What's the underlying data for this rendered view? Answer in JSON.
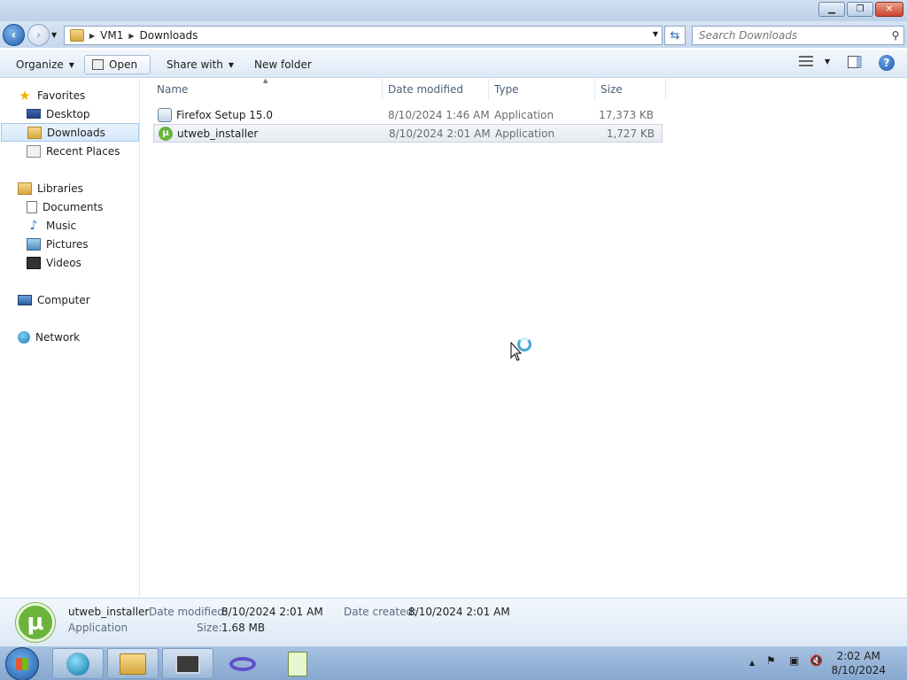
{
  "window": {
    "minimize_glyph": "▁",
    "maximize_glyph": "❐",
    "close_glyph": "✕"
  },
  "navigation": {
    "breadcrumb": [
      "VM1",
      "Downloads"
    ],
    "search_placeholder": "Search Downloads"
  },
  "toolbar": {
    "organize_label": "Organize",
    "open_label": "Open",
    "share_label": "Share with",
    "new_folder_label": "New folder"
  },
  "sidebar": {
    "favorites": {
      "label": "Favorites",
      "items": [
        "Desktop",
        "Downloads",
        "Recent Places"
      ]
    },
    "libraries": {
      "label": "Libraries",
      "items": [
        "Documents",
        "Music",
        "Pictures",
        "Videos"
      ]
    },
    "computer_label": "Computer",
    "network_label": "Network",
    "selected_item": "Downloads"
  },
  "file_list": {
    "columns": [
      "Name",
      "Date modified",
      "Type",
      "Size"
    ],
    "rows": [
      {
        "name": "Firefox Setup 15.0",
        "date": "8/10/2024 1:46 AM",
        "type": "Application",
        "size": "17,373 KB"
      },
      {
        "name": "utweb_installer",
        "date": "8/10/2024 2:01 AM",
        "type": "Application",
        "size": "1,727 KB"
      }
    ],
    "selected_index": 1
  },
  "details_pane": {
    "file_name": "utweb_installer",
    "file_type": "Application",
    "date_modified_label": "Date modified:",
    "date_modified": "8/10/2024 2:01 AM",
    "size_label": "Size:",
    "size": "1.68 MB",
    "date_created_label": "Date created:",
    "date_created": "8/10/2024 2:01 AM"
  },
  "taskbar": {
    "clock_time": "2:02 AM",
    "clock_date": "8/10/2024",
    "tray_up_glyph": "▲",
    "tray_flag_glyph": "⚑",
    "tray_network_glyph": "▣",
    "tray_volume_glyph": "🔇"
  },
  "colors": {
    "accent": "#1f58a5",
    "selection_border": "#a8c9ec",
    "utorrent_green": "#6bb43c"
  }
}
